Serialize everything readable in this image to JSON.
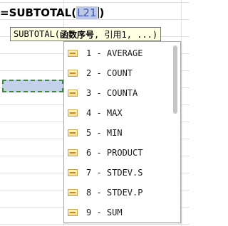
{
  "formula": {
    "prefix": "=SUBTOTAL(",
    "reference": "L21",
    "suffix": ")"
  },
  "tooltip": {
    "func": "SUBTOTAL",
    "open": " (",
    "arg1": "函数序号",
    "rest": ", 引用1, ...)"
  },
  "dropdown": {
    "items": [
      {
        "label": "1 - AVERAGE"
      },
      {
        "label": "2 - COUNT"
      },
      {
        "label": "3 - COUNTA"
      },
      {
        "label": "4 - MAX"
      },
      {
        "label": "5 - MIN"
      },
      {
        "label": "6 - PRODUCT"
      },
      {
        "label": "7 - STDEV.S"
      },
      {
        "label": "8 - STDEV.P"
      },
      {
        "label": "9 - SUM"
      }
    ]
  },
  "icons": {
    "item_icon": "function-icon"
  },
  "colors": {
    "reference_highlight": "#bcc8e6",
    "reference_text": "#3b59b5",
    "tooltip_bg": "#ffffe1",
    "cell_border": "#3c8a3c"
  }
}
